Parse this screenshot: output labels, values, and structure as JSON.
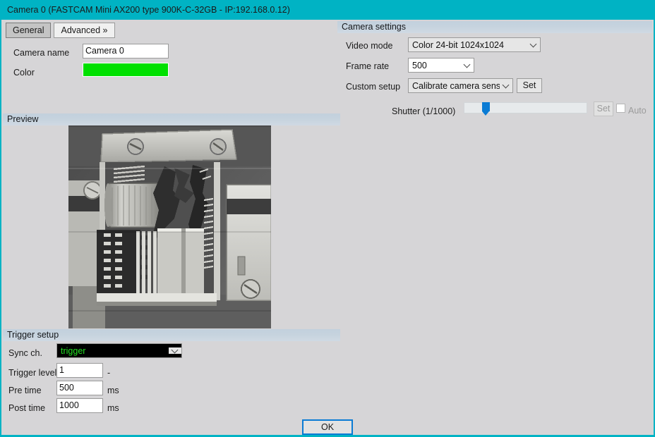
{
  "window": {
    "title": "Camera 0 (FASTCAM Mini AX200 type 900K-C-32GB - IP:192.168.0.12)",
    "accent_color": "#00b3c4",
    "client_bg": "#d6d5d7"
  },
  "tabs": [
    {
      "label": "General",
      "selected": true
    },
    {
      "label": "Advanced »",
      "selected": false
    }
  ],
  "general": {
    "camera_name_label": "Camera name",
    "camera_name_value": "Camera 0",
    "color_label": "Color",
    "color_value": "#00e000"
  },
  "preview": {
    "header": "Preview"
  },
  "camera_settings": {
    "header": "Camera settings",
    "video_mode_label": "Video mode",
    "video_mode_value": "Color 24-bit 1024x1024",
    "frame_rate_label": "Frame rate",
    "frame_rate_value": "500",
    "custom_setup_label": "Custom setup",
    "custom_setup_value": "Calibrate camera sensor",
    "custom_setup_set_label": "Set",
    "shutter_label": "Shutter (1/1000)",
    "shutter_set_label": "Set",
    "shutter_auto_label": "Auto",
    "shutter_percent": 15
  },
  "trigger_setup": {
    "header": "Trigger setup",
    "sync_ch_label": "Sync ch.",
    "sync_ch_value": "trigger",
    "sync_ch_text_color": "#22e022",
    "trigger_level_label": "Trigger level",
    "trigger_level_value": "1",
    "trigger_level_unit": "-",
    "pre_time_label": "Pre time",
    "pre_time_value": "500",
    "pre_time_unit": "ms",
    "post_time_label": "Post time",
    "post_time_value": "1000",
    "post_time_unit": "ms"
  },
  "footer": {
    "ok_label": "OK"
  }
}
